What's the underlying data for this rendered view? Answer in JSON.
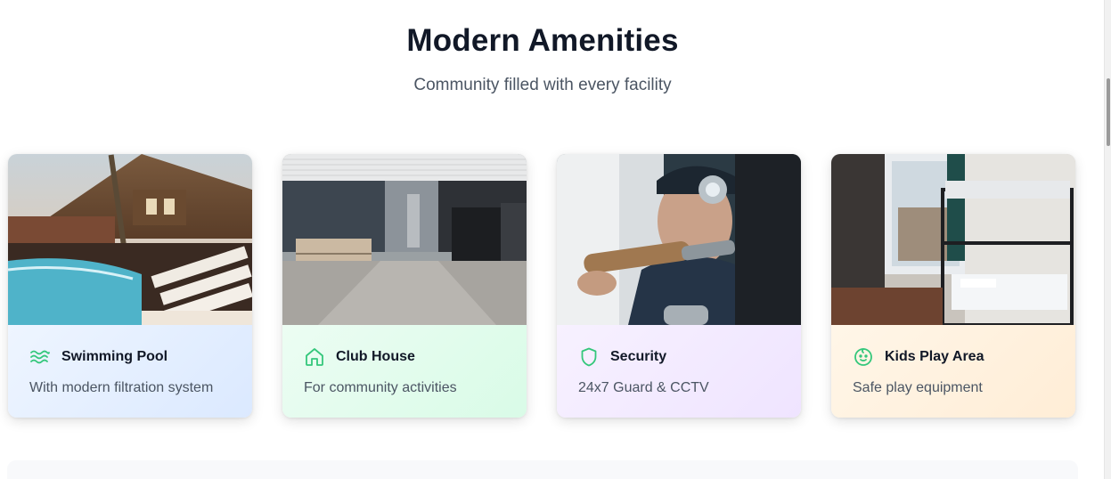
{
  "section": {
    "title": "Modern Amenities",
    "subtitle": "Community filled with every facility"
  },
  "accent_color": "#34c77b",
  "cards": [
    {
      "icon": "waves-icon",
      "title": "Swimming Pool",
      "description": "With modern filtration system",
      "background": "#e3eeff"
    },
    {
      "icon": "home-icon",
      "title": "Club House",
      "description": "For community activities",
      "background": "#e2fcec"
    },
    {
      "icon": "shield-icon",
      "title": "Security",
      "description": "24x7 Guard & CCTV",
      "background": "#f2eaff"
    },
    {
      "icon": "baby-face-icon",
      "title": "Kids Play Area",
      "description": "Safe play equipment",
      "background": "#fff1dd"
    }
  ]
}
